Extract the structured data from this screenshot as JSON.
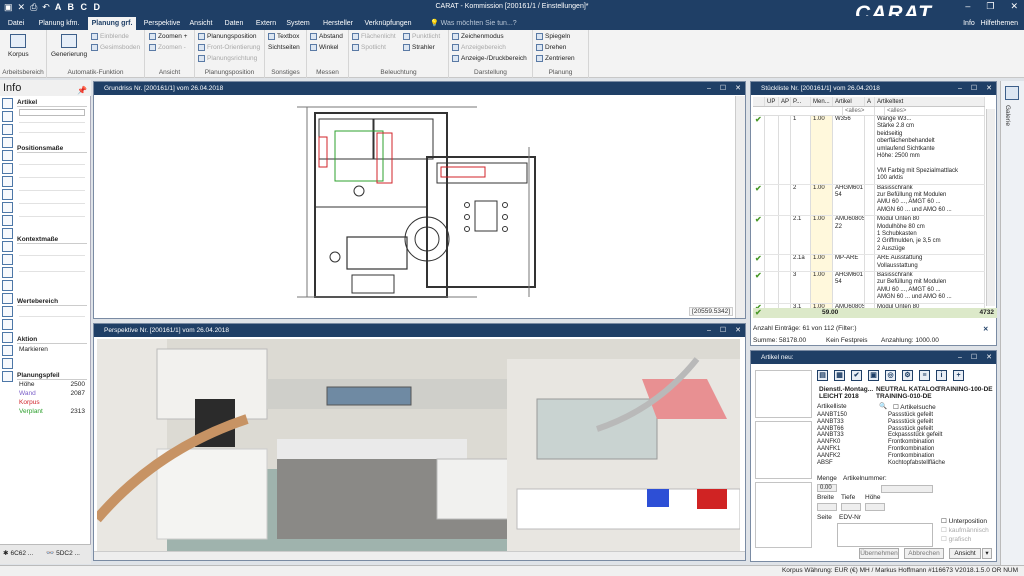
{
  "titlebar": {
    "title": "CARAT - Kommission [200161/1 / Einstellungen]*",
    "abcd": "A B C D",
    "brand": "CARAT"
  },
  "tabs": [
    {
      "label": "Datei"
    },
    {
      "label": "Planung kfm."
    },
    {
      "label": "Planung grf.",
      "active": true
    },
    {
      "label": "Perspektive"
    },
    {
      "label": "Ansicht"
    },
    {
      "label": "Daten"
    },
    {
      "label": "Extern"
    },
    {
      "label": "System"
    },
    {
      "label": "Hersteller"
    },
    {
      "label": "Verknüpfungen"
    }
  ],
  "tab_search": "Was möchten Sie tun...?",
  "tab_right": {
    "info": "Info",
    "help": "Hilfethemen"
  },
  "ribbon": {
    "arbeitsbereich": {
      "label": "Arbeitsbereich",
      "korpus": "Korpus"
    },
    "automatik": {
      "label": "Automatik-Funktion",
      "generierung": "Generierung",
      "erzeugen": "Erzeuge",
      "einblende": "Einblende",
      "gesimsboden": "Gesimsboden"
    },
    "ansicht": {
      "label": "Ansicht",
      "zoomen_plus": "Zoomen +",
      "zoomen_minus": "Zoomen -"
    },
    "planungsposition": {
      "label": "Planungsposition",
      "position": "Planungsposition",
      "front": "Front-Orientierung",
      "richtung": "Planungsrichtung"
    },
    "sonstiges": {
      "label": "Sonstiges",
      "textbox": "Textbox",
      "sichtseiten": "Sichtseiten"
    },
    "messen": {
      "label": "Messen",
      "abstand": "Abstand",
      "winkel": "Winkel"
    },
    "beleuchtung": {
      "label": "Beleuchtung",
      "flaechenlicht": "Flächenlicht",
      "punktlicht": "Punktlicht",
      "spotlicht": "Spotlicht",
      "strahler": "Strahler"
    },
    "darstellung": {
      "label": "Darstellung",
      "zeichenmodus": "Zeichenmodus",
      "anzeigebereich": "Anzeigebereich",
      "anzeige_druck": "Anzeige-/Druckbereich"
    },
    "planung": {
      "label": "Planung",
      "spiegeln": "Spiegeln",
      "drehen": "Drehen",
      "zentrieren": "Zentrieren"
    }
  },
  "left_panel": {
    "title": "Info",
    "artikel": "Artikel",
    "positionsmasse": "Positionsmaße",
    "konteatmasse": "Kontextmaße",
    "wertebereich": "Wertebereich",
    "aktion": "Aktion",
    "aktion_value": "Markieren",
    "planungspfeil": "Planungspfeil",
    "values": [
      {
        "label": "Höhe",
        "value": "2500",
        "color": "#222222"
      },
      {
        "label": "Wand",
        "value": "2087",
        "color": "#7a5ec9"
      },
      {
        "label": "Korpus",
        "value": "",
        "color": "#d0232a"
      },
      {
        "label": "Verplant",
        "value": "2313",
        "color": "#2ea02e"
      }
    ]
  },
  "bottom_tabs": {
    "tab1": "6C62 ...",
    "tab2": "5DC2 ..."
  },
  "plan_window": {
    "title": "Grundriss Nr. [200161/1] vom 26.04.2018",
    "status": "[20559.5342]"
  },
  "persp_window": {
    "title": "Perspektive Nr. [200161/1] vom 26.04.2018"
  },
  "stueckliste": {
    "title": "Stückliste Nr. [200161/1] vom 26.04.2018",
    "headers": [
      "UP",
      "AP",
      "P...",
      "Men...",
      "Artikel",
      "A",
      "Artikeltext"
    ],
    "filter": "<alles>",
    "rows": [
      {
        "check": "✔",
        "pos": "1",
        "menge": "1.00",
        "artikel": "W356",
        "text": [
          "Wange W3...",
          "Stärke 2.8 cm",
          "beidseitig",
          "oberflächenbehandelt",
          "umlaufend Sichtkante",
          "Höhe: 2500 mm",
          "",
          "VM Farbig mit Spezialmattlack",
          "100 arktis"
        ]
      },
      {
        "check": "✔",
        "pos": "2",
        "menge": "1.00",
        "artikel": "AHGM601 54",
        "text": [
          "Basisschrank",
          "zur Befüllung mit Modulen",
          "AMU 60 ..., AMGT 60 ...",
          "AMGN 60 ... und AMO 60 ..."
        ]
      },
      {
        "check": "✔",
        "pos": "2.1",
        "menge": "1.00",
        "artikel": "AMU6080S Z2",
        "text": [
          "Modul Unten 80",
          "Modulhöhe 80 cm",
          "1 Schubkasten",
          "2 Griffmulden, je 3,5 cm",
          "2 Auszüge"
        ]
      },
      {
        "check": "✔",
        "pos": "2.1a",
        "menge": "1.00",
        "artikel": "MP-ARE",
        "text": [
          "ARE Ausstattung",
          "Vollausstattung"
        ]
      },
      {
        "check": "✔",
        "pos": "3",
        "menge": "1.00",
        "artikel": "AHGM601 54",
        "text": [
          "Basisschrank",
          "zur Befüllung mit Modulen",
          "AMU 60 ..., AMGT 60 ...",
          "AMGN 60 ... und AMO 60 ..."
        ]
      },
      {
        "check": "✔",
        "pos": "3.1",
        "menge": "1.00",
        "artikel": "AMU6080S",
        "text": [
          "Modul Unten 80"
        ]
      }
    ],
    "sum_qty": "59.00",
    "sum_right": "4732",
    "anzahl": "Anzahl Einträge: 61 von 112 (Filter:)",
    "summe": "Summe: 58178.00",
    "festpreis": "Kein Festpreis",
    "anzahlung": "Anzahlung: 1000.00"
  },
  "artikel_neu": {
    "title": "Artikel neu:",
    "catalog": [
      "Dienstl.-Montag...",
      "LEICHT 2018",
      "NEUTRAL KATALOG",
      "TRAINING-010-DE",
      "TRAINING-100-DE"
    ],
    "artikelliste": "Artikelliste",
    "artikelsuche": "Artikelsuche",
    "list": [
      {
        "code": "AANBT150",
        "text": "Passstück gefeilt"
      },
      {
        "code": "AANBT33",
        "text": "Passstück gefeilt"
      },
      {
        "code": "AANBT66",
        "text": "Passstück gefeilt"
      },
      {
        "code": "AANBT33",
        "text": "Eckpassstück gefeilt"
      },
      {
        "code": "AANFK0",
        "text": "Frontkombination"
      },
      {
        "code": "AANFK1",
        "text": "Frontkombination"
      },
      {
        "code": "AANFK2",
        "text": "Frontkombination"
      },
      {
        "code": "ABSF",
        "text": "Kochtopfabstellfläche"
      }
    ],
    "menge": "Menge",
    "menge_val": "0.00",
    "artikelnummer": "Artikelnummer:",
    "breite": "Breite",
    "tiefe": "Tiefe",
    "hoehe": "Höhe",
    "seite": "Seite",
    "edv": "EDV-Nr",
    "unterposition": "Unterposition",
    "kaufmaennisch": "kaufmännisch",
    "grafisch": "grafisch",
    "btn_uebernehmen": "Übernehmen",
    "btn_abbrechen": "Abbrechen",
    "btn_ansicht": "Ansicht"
  },
  "gallery": {
    "label": "Galerie"
  },
  "statusbar": "Korpus  Währung: EUR (€)  MH / Markus Hoffmann  #116673  V2018.1.5.0  OR  NUM"
}
